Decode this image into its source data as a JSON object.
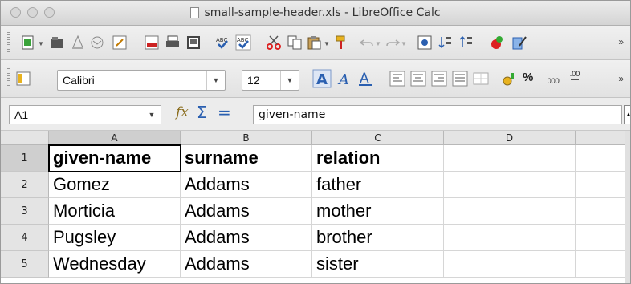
{
  "window": {
    "title": "small-sample-header.xls - LibreOffice Calc"
  },
  "toolbar_standard": {
    "icons": [
      "new-icon",
      "open-icon",
      "save-icon",
      "email-icon",
      "edit-icon",
      "export-pdf-icon",
      "print-icon",
      "print-preview-icon",
      "spellcheck-icon",
      "autospell-icon",
      "cut-icon",
      "copy-icon",
      "paste-icon",
      "clone-format-icon",
      "undo-icon",
      "redo-icon",
      "navigator-icon",
      "sort-ascending-icon",
      "sort-descending-icon",
      "gallery-icon",
      "draw-icon"
    ],
    "overflow": "»"
  },
  "toolbar_format": {
    "font_name": "Calibri",
    "font_size": "12",
    "percent_label": "%",
    "decimal_add_label": ".000",
    "decimal_del_label": ".00",
    "overflow": "»"
  },
  "formula_bar": {
    "name_box": "A1",
    "fx": "fx",
    "sigma": "Σ",
    "equals": "=",
    "content": "given-name"
  },
  "sheet": {
    "columns": [
      "A",
      "B",
      "C",
      "D"
    ],
    "rows": [
      {
        "num": "1",
        "cells": [
          "given-name",
          "surname",
          "relation",
          ""
        ]
      },
      {
        "num": "2",
        "cells": [
          "Gomez",
          "Addams",
          "father",
          ""
        ]
      },
      {
        "num": "3",
        "cells": [
          "Morticia",
          "Addams",
          "mother",
          ""
        ]
      },
      {
        "num": "4",
        "cells": [
          "Pugsley",
          "Addams",
          "brother",
          ""
        ]
      },
      {
        "num": "5",
        "cells": [
          "Wednesday",
          "Addams",
          "sister",
          ""
        ]
      }
    ],
    "selected_cell": "A1"
  },
  "colors": {
    "accent_blue": "#2a5fb0",
    "header_bg": "#e4e4e4",
    "selected_header_bg": "#cfcfcf"
  }
}
